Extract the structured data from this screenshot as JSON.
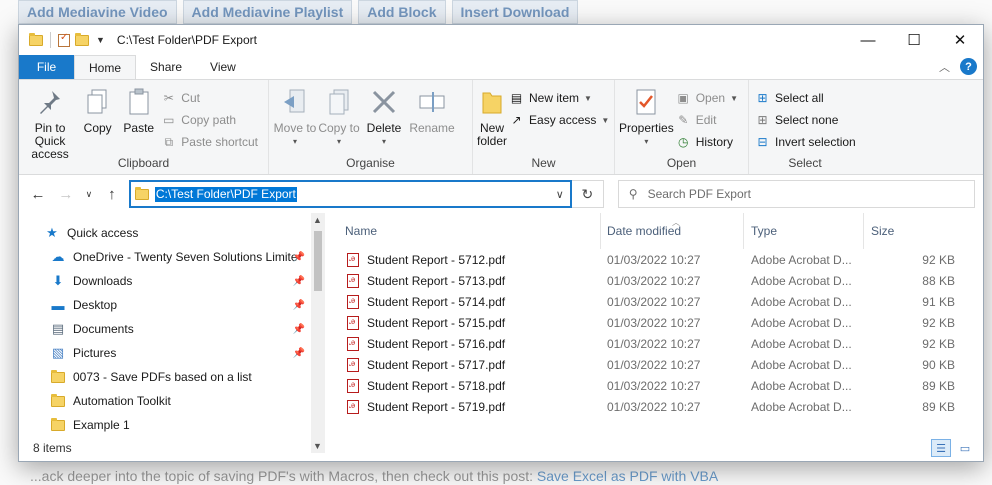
{
  "background": {
    "toolbar_buttons": [
      "Add Mediavine Video",
      "Add Mediavine Playlist",
      "Add Block",
      "Insert Download"
    ],
    "bottom_text": "...ack deeper into the topic of saving PDF's with Macros, then check out this post:",
    "bottom_link": "Save Excel as PDF with VBA"
  },
  "window": {
    "title": "C:\\Test Folder\\PDF Export",
    "controls": {
      "minimize": "—",
      "maximize": "☐",
      "close": "✕"
    }
  },
  "tabs": [
    "File",
    "Home",
    "Share",
    "View"
  ],
  "ribbon": {
    "clipboard": {
      "label": "Clipboard",
      "pin": "Pin to Quick access",
      "copy": "Copy",
      "paste": "Paste",
      "cut": "Cut",
      "copy_path": "Copy path",
      "paste_shortcut": "Paste shortcut"
    },
    "organise": {
      "label": "Organise",
      "move_to": "Move to",
      "copy_to": "Copy to",
      "delete": "Delete",
      "rename": "Rename"
    },
    "new": {
      "label": "New",
      "new_folder": "New folder",
      "new_item": "New item",
      "easy_access": "Easy access"
    },
    "open": {
      "label": "Open",
      "properties": "Properties",
      "open": "Open",
      "edit": "Edit",
      "history": "History"
    },
    "select": {
      "label": "Select",
      "select_all": "Select all",
      "select_none": "Select none",
      "invert_selection": "Invert selection"
    }
  },
  "address": {
    "path": "C:\\Test Folder\\PDF Export",
    "search_placeholder": "Search PDF Export"
  },
  "nav": {
    "quick_access": "Quick access",
    "items": [
      {
        "label": "OneDrive - Twenty Seven Solutions Limite",
        "icon": "cloud-icon",
        "pinned": true
      },
      {
        "label": "Downloads",
        "icon": "download-icon",
        "pinned": true
      },
      {
        "label": "Desktop",
        "icon": "desktop-icon",
        "pinned": true
      },
      {
        "label": "Documents",
        "icon": "documents-icon",
        "pinned": true
      },
      {
        "label": "Pictures",
        "icon": "pictures-icon",
        "pinned": true
      },
      {
        "label": "0073 - Save PDFs based on a list",
        "icon": "folder-icon",
        "pinned": false
      },
      {
        "label": "Automation Toolkit",
        "icon": "folder-icon",
        "pinned": false
      },
      {
        "label": "Example 1",
        "icon": "folder-icon",
        "pinned": false
      }
    ]
  },
  "columns": {
    "name": "Name",
    "date": "Date modified",
    "type": "Type",
    "size": "Size"
  },
  "files": [
    {
      "name": "Student Report - 5712.pdf",
      "date": "01/03/2022 10:27",
      "type": "Adobe Acrobat D...",
      "size": "92 KB"
    },
    {
      "name": "Student Report - 5713.pdf",
      "date": "01/03/2022 10:27",
      "type": "Adobe Acrobat D...",
      "size": "88 KB"
    },
    {
      "name": "Student Report - 5714.pdf",
      "date": "01/03/2022 10:27",
      "type": "Adobe Acrobat D...",
      "size": "91 KB"
    },
    {
      "name": "Student Report - 5715.pdf",
      "date": "01/03/2022 10:27",
      "type": "Adobe Acrobat D...",
      "size": "92 KB"
    },
    {
      "name": "Student Report - 5716.pdf",
      "date": "01/03/2022 10:27",
      "type": "Adobe Acrobat D...",
      "size": "92 KB"
    },
    {
      "name": "Student Report - 5717.pdf",
      "date": "01/03/2022 10:27",
      "type": "Adobe Acrobat D...",
      "size": "90 KB"
    },
    {
      "name": "Student Report - 5718.pdf",
      "date": "01/03/2022 10:27",
      "type": "Adobe Acrobat D...",
      "size": "89 KB"
    },
    {
      "name": "Student Report - 5719.pdf",
      "date": "01/03/2022 10:27",
      "type": "Adobe Acrobat D...",
      "size": "89 KB"
    }
  ],
  "status": {
    "count": "8 items"
  }
}
